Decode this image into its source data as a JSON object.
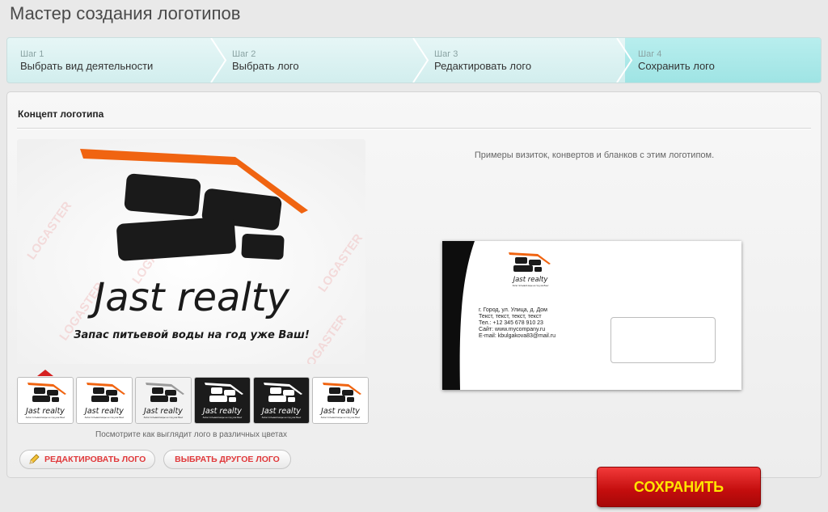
{
  "page": {
    "title": "Мастер создания логотипов"
  },
  "steps": [
    {
      "num": "Шаг 1",
      "label": "Выбрать вид деятельности"
    },
    {
      "num": "Шаг 2",
      "label": "Выбрать лого"
    },
    {
      "num": "Шаг 3",
      "label": "Редактировать лого"
    },
    {
      "num": "Шаг 4",
      "label": "Сохранить лого"
    }
  ],
  "active_step": 4,
  "concept": {
    "title": "Концепт логотипа",
    "logo_name": "Jast realty",
    "slogan": "Запас питьевой воды на год уже Ваш!",
    "watermark": "LOGASTER",
    "variants_caption": "Посмотрите как выглядит лого в различных цветах",
    "variants": [
      {
        "theme": "light",
        "roof": "#f06411",
        "selected": true
      },
      {
        "theme": "light",
        "roof": "#f06411"
      },
      {
        "theme": "light-gray",
        "roof": "#9a9a9a"
      },
      {
        "theme": "dark",
        "roof": "#ffffff"
      },
      {
        "theme": "dark",
        "roof": "#ffffff"
      },
      {
        "theme": "light",
        "roof": "#f06411"
      }
    ]
  },
  "buttons": {
    "edit_logo": "Редактировать лого",
    "choose_other": "Выбрать другое лого",
    "save": "СОХРАНИТЬ"
  },
  "examples": {
    "caption": "Примеры визиток, конвертов и бланков с этим логотипом.",
    "envelope_address": [
      "г. Город, ул. Улица, д. Дом",
      "Текст, текст, текст, текст",
      "Тел.: +12 345 678 910 23",
      "Сайт: www.mycompany.ru",
      "E-mail: kbulgakova83@mail.ru"
    ]
  },
  "colors": {
    "brand_orange": "#f06411",
    "accent_red": "#e0383a",
    "save_text": "#ffe600",
    "steps_bg": "#d9f1f1",
    "active_step_bg": "#a9e8e8"
  }
}
